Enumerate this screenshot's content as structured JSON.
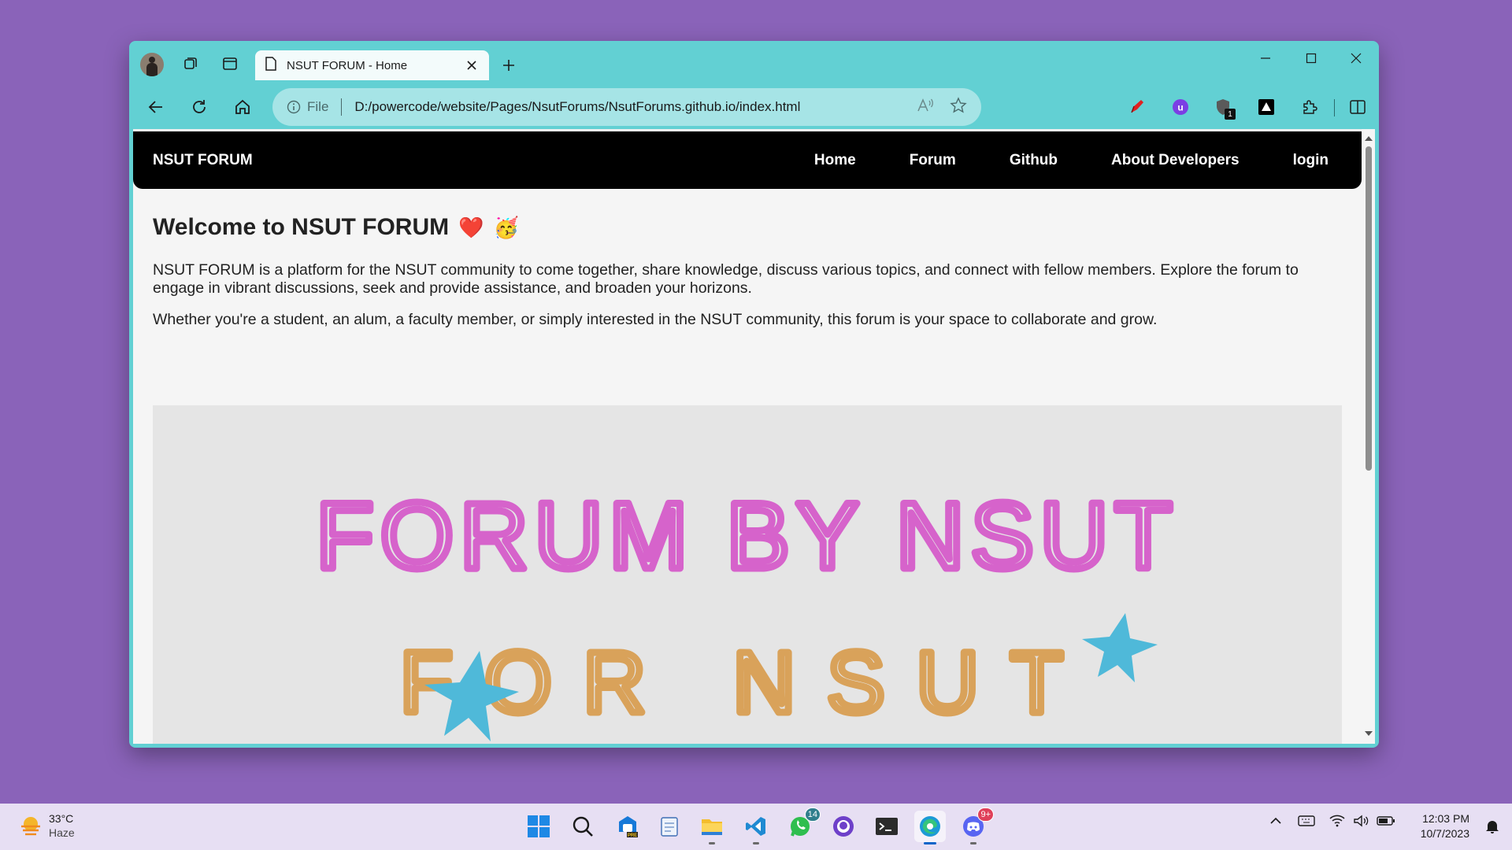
{
  "browser": {
    "tab_title": "NSUT FORUM - Home",
    "address": {
      "info_label": "File",
      "url": "D:/powercode/website/Pages/NsutForums/NsutForums.github.io/index.html"
    },
    "extension_badge": "1"
  },
  "site": {
    "brand": "NSUT FORUM",
    "nav": [
      "Home",
      "Forum",
      "Github",
      "About Developers",
      "login"
    ],
    "heading": "Welcome to NSUT FORUM",
    "heading_emojis": [
      "❤️",
      "🥳"
    ],
    "intro": "NSUT FORUM is a platform for the NSUT community to come together, share knowledge, discuss various topics, and connect with fellow members. Explore the forum to engage in vibrant discussions, seek and provide assistance, and broaden your horizons.",
    "secondary": "Whether you're a student, an alum, a faculty member, or simply interested in the NSUT community, this forum is your space to collaborate and grow.",
    "banner_lines": [
      "FORUM BY NSUT",
      "FOR NSUT"
    ]
  },
  "taskbar": {
    "weather_temp": "33°C",
    "weather_cond": "Haze",
    "whatsapp_badge": "14",
    "discord_badge": "9+",
    "time": "12:03 PM",
    "date": "10/7/2023"
  },
  "colors": {
    "desktop": "#8a63b9",
    "browser_frame": "#62d0d3",
    "omnibox": "#a6e4e6",
    "site_nav": "#000000",
    "page_bg": "#f5f5f5",
    "banner_bg": "#e5e5e5",
    "taskbar": "#e7dff3",
    "pink": "#d663cb",
    "green": "#8ccf4a",
    "red": "#e06070",
    "orange": "#d9a25a",
    "yellow": "#d6d84a",
    "blue": "#4fb9d9"
  }
}
